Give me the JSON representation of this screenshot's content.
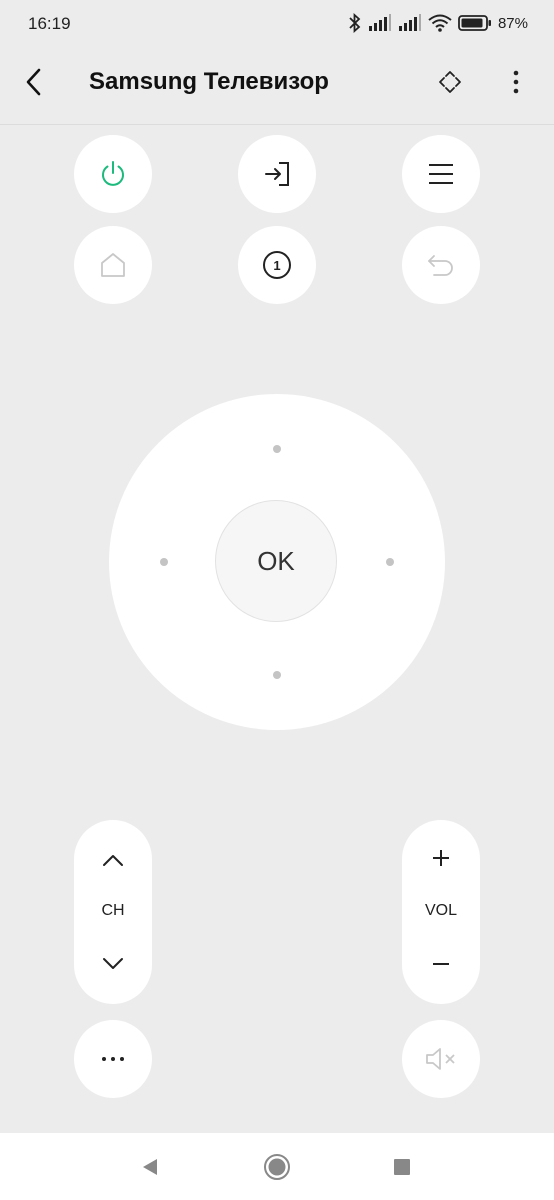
{
  "status_bar": {
    "time": "16:19",
    "battery": "87%"
  },
  "header": {
    "title": "Samsung Телевизор"
  },
  "remote": {
    "ok_label": "OK",
    "channel_label": "CH",
    "volume_label": "VOL",
    "input_badge": "1"
  },
  "colors": {
    "power_icon": "#1dba7d",
    "disabled_icon": "#c8c8c8",
    "background": "#ececec"
  }
}
